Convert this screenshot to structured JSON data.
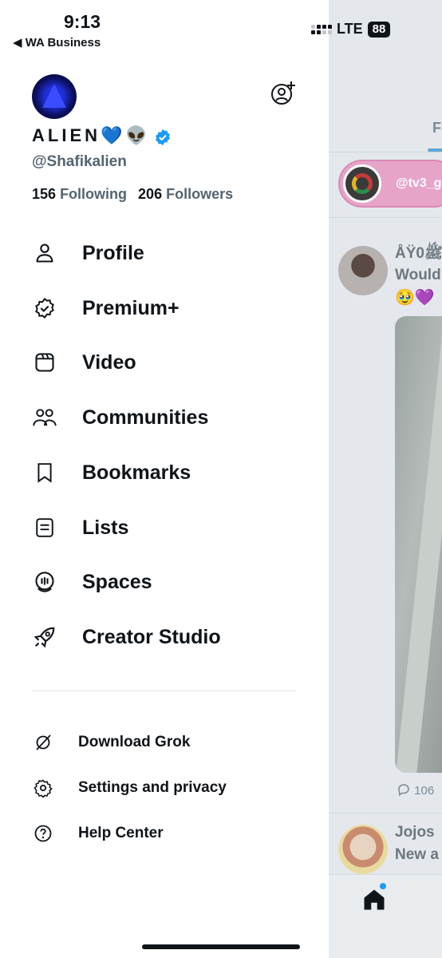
{
  "status_bar": {
    "time": "9:13",
    "back_label": "◀ WA Business",
    "network": "LTE",
    "battery": "88"
  },
  "profile": {
    "display_name": "ALIEN💙👽",
    "username": "@Shafikalien",
    "following_count": "156",
    "following_label": "Following",
    "followers_count": "206",
    "followers_label": "Followers"
  },
  "menu": [
    {
      "label": "Profile",
      "icon": "person-icon"
    },
    {
      "label": "Premium+",
      "icon": "verified-badge-icon"
    },
    {
      "label": "Video",
      "icon": "video-icon"
    },
    {
      "label": "Communities",
      "icon": "communities-icon"
    },
    {
      "label": "Bookmarks",
      "icon": "bookmark-icon"
    },
    {
      "label": "Lists",
      "icon": "list-icon"
    },
    {
      "label": "Spaces",
      "icon": "spaces-icon"
    },
    {
      "label": "Creator Studio",
      "icon": "rocket-icon"
    }
  ],
  "secondary_menu": [
    {
      "label": "Download Grok",
      "icon": "grok-icon"
    },
    {
      "label": "Settings and privacy",
      "icon": "gear-icon"
    },
    {
      "label": "Help Center",
      "icon": "help-icon"
    }
  ],
  "feed": {
    "tab_partial": "Fo",
    "live_handle": "@tv3_g",
    "post_name": "ÅŸ0ﷺ",
    "post_text": "Would",
    "post_emojis": "🥹💜",
    "post_reply_count": "106",
    "post2_name": "Jojos",
    "post2_text": "New a"
  },
  "colors": {
    "accent": "#1d9bf0",
    "text_primary": "#0f1419",
    "text_secondary": "#536471",
    "live_pill": "#e6a4c9"
  }
}
